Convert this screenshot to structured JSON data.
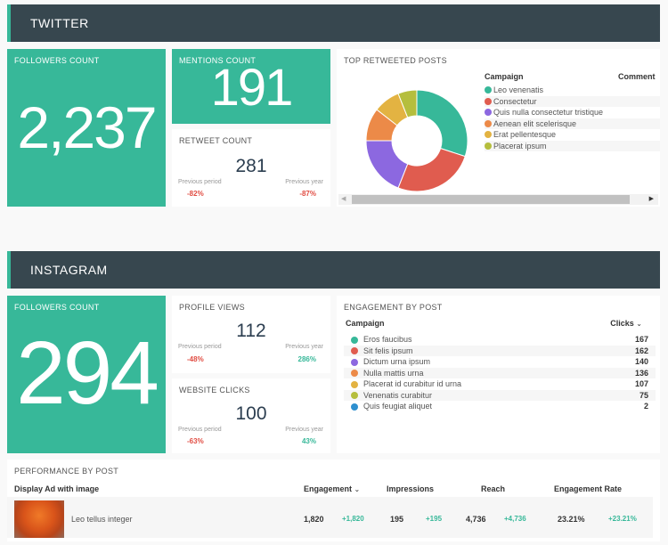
{
  "twitter": {
    "header": "TWITTER",
    "followers": {
      "title": "FOLLOWERS COUNT",
      "value": "2,237"
    },
    "mentions": {
      "title": "MENTIONS COUNT",
      "value": "191"
    },
    "retweets": {
      "title": "RETWEET COUNT",
      "value": "281",
      "prev_period_label": "Previous period",
      "prev_period_value": "-82%",
      "prev_year_label": "Previous year",
      "prev_year_value": "-87%"
    },
    "top_posts": {
      "title": "TOP RETWEETED POSTS",
      "col_campaign": "Campaign",
      "col_comment": "Comment",
      "items": [
        {
          "label": "Leo venenatis",
          "color": "#37b899"
        },
        {
          "label": "Consectetur",
          "color": "#e05c4f"
        },
        {
          "label": "Quis nulla consectetur tristique",
          "color": "#8c68e0"
        },
        {
          "label": "Aenean elit scelerisque",
          "color": "#ec8a48"
        },
        {
          "label": "Erat pellentesque",
          "color": "#e3b342"
        },
        {
          "label": "Placerat ipsum",
          "color": "#b5be3d"
        }
      ]
    }
  },
  "chart_data": {
    "type": "pie",
    "title": "TOP RETWEETED POSTS",
    "categories": [
      "Leo venenatis",
      "Consectetur",
      "Quis nulla consectetur tristique",
      "Aenean elit scelerisque",
      "Erat pellentesque",
      "Placerat ipsum"
    ],
    "values": [
      30,
      26,
      19,
      10.5,
      8.5,
      6
    ],
    "colors": [
      "#37b899",
      "#e05c4f",
      "#8c68e0",
      "#ec8a48",
      "#e3b342",
      "#b5be3d"
    ],
    "donut": true
  },
  "instagram": {
    "header": "INSTAGRAM",
    "followers": {
      "title": "FOLLOWERS COUNT",
      "value": "294"
    },
    "profile_views": {
      "title": "PROFILE VIEWS",
      "value": "112",
      "prev_period_label": "Previous period",
      "prev_period_value": "-48%",
      "prev_year_label": "Previous year",
      "prev_year_value": "286%"
    },
    "website_clicks": {
      "title": "WEBSITE CLICKS",
      "value": "100",
      "prev_period_label": "Previous period",
      "prev_period_value": "-63%",
      "prev_year_label": "Previous year",
      "prev_year_value": "43%"
    },
    "engagement": {
      "title": "ENGAGEMENT BY POST",
      "col_campaign": "Campaign",
      "col_clicks": "Clicks",
      "rows": [
        {
          "label": "Eros faucibus",
          "value": "167",
          "color": "#37b899"
        },
        {
          "label": "Sit felis ipsum",
          "value": "162",
          "color": "#e05c4f"
        },
        {
          "label": "Dictum urna ipsum",
          "value": "140",
          "color": "#8c68e0"
        },
        {
          "label": "Nulla mattis urna",
          "value": "136",
          "color": "#ec8a48"
        },
        {
          "label": "Placerat id curabitur id urna",
          "value": "107",
          "color": "#e3b342"
        },
        {
          "label": "Venenatis curabitur",
          "value": "75",
          "color": "#b5be3d"
        },
        {
          "label": "Quis feugiat aliquet",
          "value": "2",
          "color": "#2e8fcf"
        }
      ]
    },
    "performance": {
      "title": "PERFORMANCE BY POST",
      "col_ad": "Display Ad with image",
      "col_engagement": "Engagement",
      "col_impressions": "Impressions",
      "col_reach": "Reach",
      "col_rate": "Engagement Rate",
      "row": {
        "name": "Leo tellus integer",
        "engagement": "1,820",
        "engagement_delta": "+1,820",
        "impressions": "195",
        "impressions_delta": "+195",
        "reach": "4,736",
        "reach_delta": "+4,736",
        "rate": "23.21%",
        "rate_delta": "+23.21%"
      }
    }
  }
}
